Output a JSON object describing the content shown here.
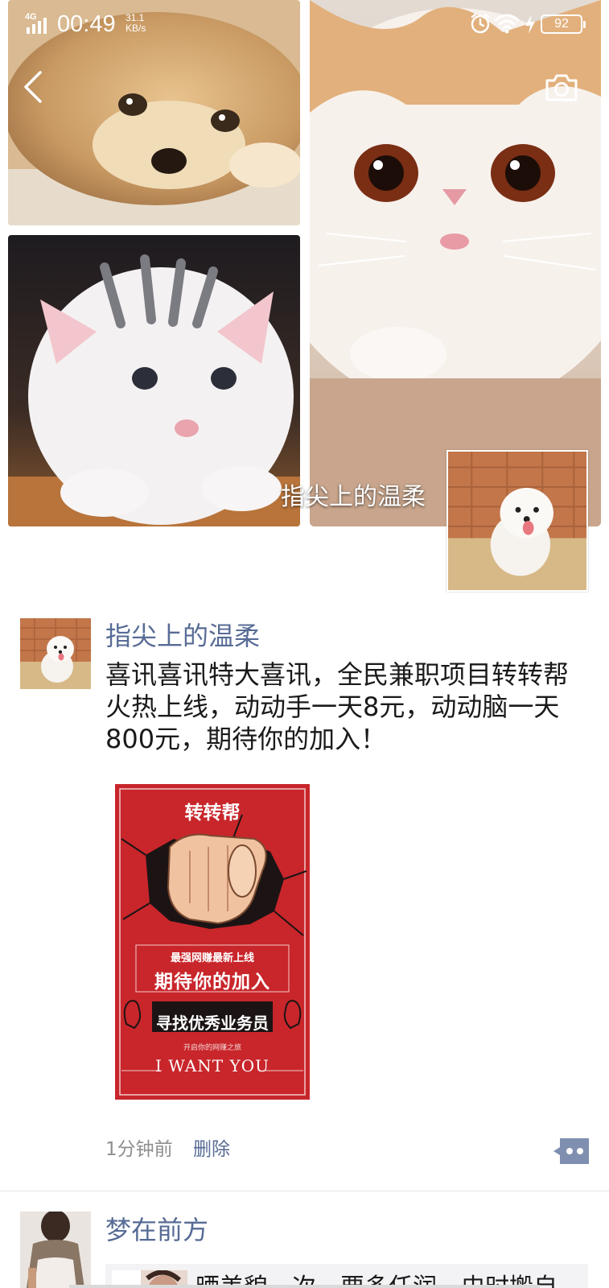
{
  "status_bar": {
    "network": "4G",
    "time": "00:49",
    "speed_value": "31.1",
    "speed_unit": "KB/s",
    "battery": "92",
    "icons": [
      "signal-icon",
      "alarm-icon",
      "wifi-icon",
      "charging-icon",
      "battery-icon"
    ]
  },
  "header": {
    "back_icon": "chevron-left-icon",
    "camera_icon": "camera-icon"
  },
  "cover": {
    "name": "指尖上的温柔"
  },
  "posts": [
    {
      "author": "指尖上的温柔",
      "text": "喜讯喜讯特大喜讯，全民兼职项目转转帮火热上线，动动手一天8元，动动脑一天800元，期待你的加入！",
      "poster": {
        "title": "转转帮",
        "line1": "最强网赚最新上线",
        "line2": "期待你的加入",
        "line3": "寻找优秀业务员",
        "line4": "开启你的网赚之旅",
        "line5": "I WANT YOU"
      },
      "time": "1分钟前",
      "delete_label": "删除",
      "more_icon": "comment-dots-icon"
    },
    {
      "author": "梦在前方",
      "share_text": "晒美貌一次，要多任润，史时搬自"
    }
  ],
  "colors": {
    "link_blue": "#576b95",
    "poster_red": "#c8262b",
    "divider": "#e5e5e5"
  }
}
